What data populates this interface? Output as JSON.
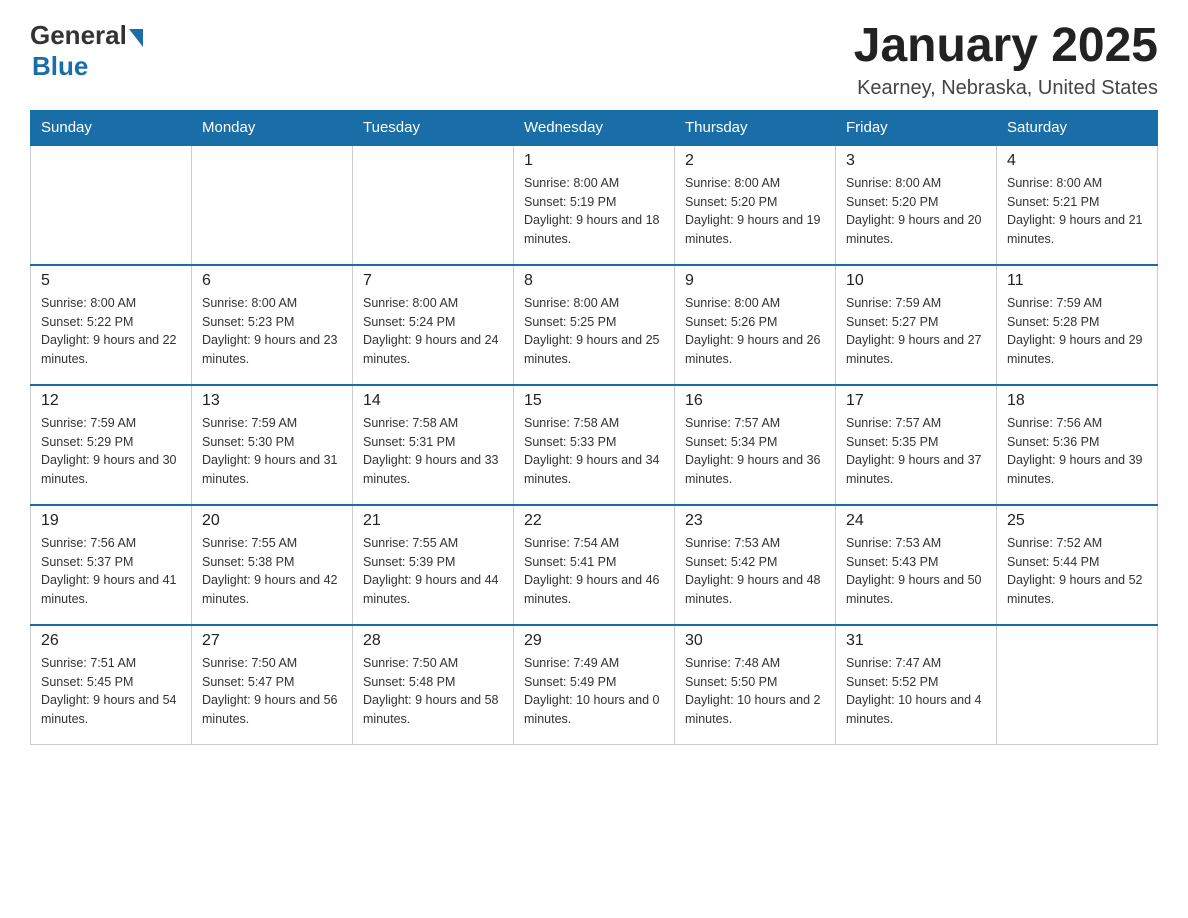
{
  "header": {
    "logo_general": "General",
    "logo_blue": "Blue",
    "title": "January 2025",
    "subtitle": "Kearney, Nebraska, United States"
  },
  "days_of_week": [
    "Sunday",
    "Monday",
    "Tuesday",
    "Wednesday",
    "Thursday",
    "Friday",
    "Saturday"
  ],
  "weeks": [
    [
      {
        "day": "",
        "sunrise": "",
        "sunset": "",
        "daylight": ""
      },
      {
        "day": "",
        "sunrise": "",
        "sunset": "",
        "daylight": ""
      },
      {
        "day": "",
        "sunrise": "",
        "sunset": "",
        "daylight": ""
      },
      {
        "day": "1",
        "sunrise": "Sunrise: 8:00 AM",
        "sunset": "Sunset: 5:19 PM",
        "daylight": "Daylight: 9 hours and 18 minutes."
      },
      {
        "day": "2",
        "sunrise": "Sunrise: 8:00 AM",
        "sunset": "Sunset: 5:20 PM",
        "daylight": "Daylight: 9 hours and 19 minutes."
      },
      {
        "day": "3",
        "sunrise": "Sunrise: 8:00 AM",
        "sunset": "Sunset: 5:20 PM",
        "daylight": "Daylight: 9 hours and 20 minutes."
      },
      {
        "day": "4",
        "sunrise": "Sunrise: 8:00 AM",
        "sunset": "Sunset: 5:21 PM",
        "daylight": "Daylight: 9 hours and 21 minutes."
      }
    ],
    [
      {
        "day": "5",
        "sunrise": "Sunrise: 8:00 AM",
        "sunset": "Sunset: 5:22 PM",
        "daylight": "Daylight: 9 hours and 22 minutes."
      },
      {
        "day": "6",
        "sunrise": "Sunrise: 8:00 AM",
        "sunset": "Sunset: 5:23 PM",
        "daylight": "Daylight: 9 hours and 23 minutes."
      },
      {
        "day": "7",
        "sunrise": "Sunrise: 8:00 AM",
        "sunset": "Sunset: 5:24 PM",
        "daylight": "Daylight: 9 hours and 24 minutes."
      },
      {
        "day": "8",
        "sunrise": "Sunrise: 8:00 AM",
        "sunset": "Sunset: 5:25 PM",
        "daylight": "Daylight: 9 hours and 25 minutes."
      },
      {
        "day": "9",
        "sunrise": "Sunrise: 8:00 AM",
        "sunset": "Sunset: 5:26 PM",
        "daylight": "Daylight: 9 hours and 26 minutes."
      },
      {
        "day": "10",
        "sunrise": "Sunrise: 7:59 AM",
        "sunset": "Sunset: 5:27 PM",
        "daylight": "Daylight: 9 hours and 27 minutes."
      },
      {
        "day": "11",
        "sunrise": "Sunrise: 7:59 AM",
        "sunset": "Sunset: 5:28 PM",
        "daylight": "Daylight: 9 hours and 29 minutes."
      }
    ],
    [
      {
        "day": "12",
        "sunrise": "Sunrise: 7:59 AM",
        "sunset": "Sunset: 5:29 PM",
        "daylight": "Daylight: 9 hours and 30 minutes."
      },
      {
        "day": "13",
        "sunrise": "Sunrise: 7:59 AM",
        "sunset": "Sunset: 5:30 PM",
        "daylight": "Daylight: 9 hours and 31 minutes."
      },
      {
        "day": "14",
        "sunrise": "Sunrise: 7:58 AM",
        "sunset": "Sunset: 5:31 PM",
        "daylight": "Daylight: 9 hours and 33 minutes."
      },
      {
        "day": "15",
        "sunrise": "Sunrise: 7:58 AM",
        "sunset": "Sunset: 5:33 PM",
        "daylight": "Daylight: 9 hours and 34 minutes."
      },
      {
        "day": "16",
        "sunrise": "Sunrise: 7:57 AM",
        "sunset": "Sunset: 5:34 PM",
        "daylight": "Daylight: 9 hours and 36 minutes."
      },
      {
        "day": "17",
        "sunrise": "Sunrise: 7:57 AM",
        "sunset": "Sunset: 5:35 PM",
        "daylight": "Daylight: 9 hours and 37 minutes."
      },
      {
        "day": "18",
        "sunrise": "Sunrise: 7:56 AM",
        "sunset": "Sunset: 5:36 PM",
        "daylight": "Daylight: 9 hours and 39 minutes."
      }
    ],
    [
      {
        "day": "19",
        "sunrise": "Sunrise: 7:56 AM",
        "sunset": "Sunset: 5:37 PM",
        "daylight": "Daylight: 9 hours and 41 minutes."
      },
      {
        "day": "20",
        "sunrise": "Sunrise: 7:55 AM",
        "sunset": "Sunset: 5:38 PM",
        "daylight": "Daylight: 9 hours and 42 minutes."
      },
      {
        "day": "21",
        "sunrise": "Sunrise: 7:55 AM",
        "sunset": "Sunset: 5:39 PM",
        "daylight": "Daylight: 9 hours and 44 minutes."
      },
      {
        "day": "22",
        "sunrise": "Sunrise: 7:54 AM",
        "sunset": "Sunset: 5:41 PM",
        "daylight": "Daylight: 9 hours and 46 minutes."
      },
      {
        "day": "23",
        "sunrise": "Sunrise: 7:53 AM",
        "sunset": "Sunset: 5:42 PM",
        "daylight": "Daylight: 9 hours and 48 minutes."
      },
      {
        "day": "24",
        "sunrise": "Sunrise: 7:53 AM",
        "sunset": "Sunset: 5:43 PM",
        "daylight": "Daylight: 9 hours and 50 minutes."
      },
      {
        "day": "25",
        "sunrise": "Sunrise: 7:52 AM",
        "sunset": "Sunset: 5:44 PM",
        "daylight": "Daylight: 9 hours and 52 minutes."
      }
    ],
    [
      {
        "day": "26",
        "sunrise": "Sunrise: 7:51 AM",
        "sunset": "Sunset: 5:45 PM",
        "daylight": "Daylight: 9 hours and 54 minutes."
      },
      {
        "day": "27",
        "sunrise": "Sunrise: 7:50 AM",
        "sunset": "Sunset: 5:47 PM",
        "daylight": "Daylight: 9 hours and 56 minutes."
      },
      {
        "day": "28",
        "sunrise": "Sunrise: 7:50 AM",
        "sunset": "Sunset: 5:48 PM",
        "daylight": "Daylight: 9 hours and 58 minutes."
      },
      {
        "day": "29",
        "sunrise": "Sunrise: 7:49 AM",
        "sunset": "Sunset: 5:49 PM",
        "daylight": "Daylight: 10 hours and 0 minutes."
      },
      {
        "day": "30",
        "sunrise": "Sunrise: 7:48 AM",
        "sunset": "Sunset: 5:50 PM",
        "daylight": "Daylight: 10 hours and 2 minutes."
      },
      {
        "day": "31",
        "sunrise": "Sunrise: 7:47 AM",
        "sunset": "Sunset: 5:52 PM",
        "daylight": "Daylight: 10 hours and 4 minutes."
      },
      {
        "day": "",
        "sunrise": "",
        "sunset": "",
        "daylight": ""
      }
    ]
  ]
}
